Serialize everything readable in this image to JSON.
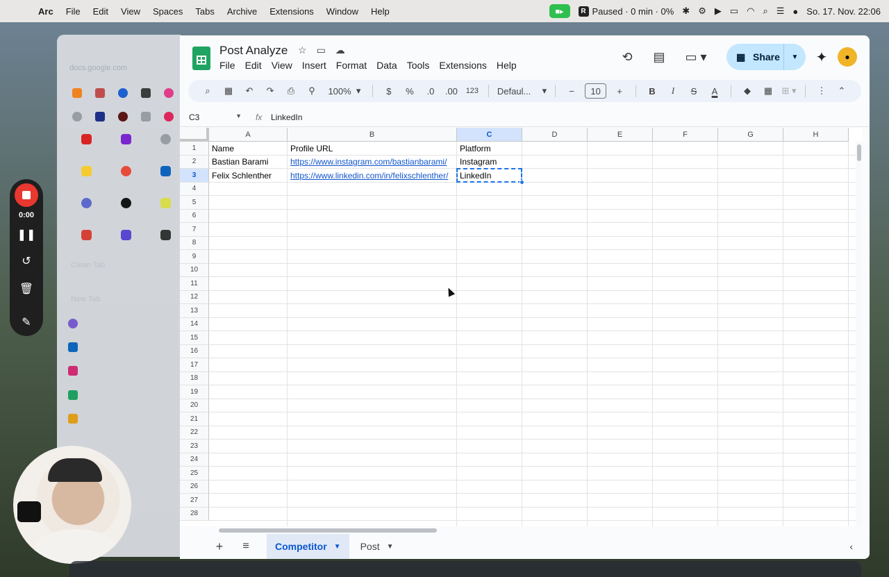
{
  "menubar": {
    "app": "Arc",
    "items": [
      "File",
      "Edit",
      "View",
      "Spaces",
      "Tabs",
      "Archive",
      "Extensions",
      "Window",
      "Help"
    ],
    "recorder_status": "Paused · 0 min · 0%",
    "datetime": "So. 17. Nov.  22:06"
  },
  "arc": {
    "url": "docs.google.com",
    "clean_tab": "Clean Tab",
    "new_tab": "New Tab"
  },
  "recorder": {
    "time": "0:00"
  },
  "sheets": {
    "title": "Post Analyze",
    "menu": [
      "File",
      "Edit",
      "View",
      "Insert",
      "Format",
      "Data",
      "Tools",
      "Extensions",
      "Help"
    ],
    "share_label": "Share",
    "toolbar": {
      "zoom": "100%",
      "currency": "$",
      "percent": "%",
      "dec_decrease": ".0",
      "dec_increase": ".00",
      "number_format": "123",
      "font": "Defaul...",
      "font_size": "10",
      "bold": "B",
      "italic": "I",
      "strike": "S",
      "text_color": "A"
    },
    "name_box": "C3",
    "formula_value": "LinkedIn",
    "columns": [
      "A",
      "B",
      "C",
      "D",
      "E",
      "F",
      "G",
      "H"
    ],
    "selected_column": "C",
    "selected_row": "3",
    "rows": [
      "1",
      "2",
      "3",
      "4",
      "5",
      "6",
      "7",
      "8",
      "9",
      "10",
      "11",
      "12",
      "13",
      "14",
      "15",
      "16",
      "17",
      "18",
      "19",
      "20",
      "21",
      "22",
      "23",
      "24",
      "25",
      "26",
      "27",
      "28"
    ],
    "cells": {
      "a1": "Name",
      "b1": "Profile URL",
      "c1": "Platform",
      "a2": "Bastian Barami",
      "b2": "https://www.instagram.com/bastianbarami/",
      "c2": "Instagram",
      "a3": "Felix Schlenther",
      "b3": "https://www.linkedin.com/in/felixschlenther/",
      "c3": "LinkedIn"
    },
    "sheet_tabs": [
      "Competitor",
      "Post"
    ],
    "active_tab": "Competitor"
  },
  "colors": {
    "accent": "#0b57d0",
    "share_bg": "#c2e7ff",
    "sheets_green": "#1fa463",
    "record_red": "#e8382f",
    "link": "#1155cc"
  }
}
